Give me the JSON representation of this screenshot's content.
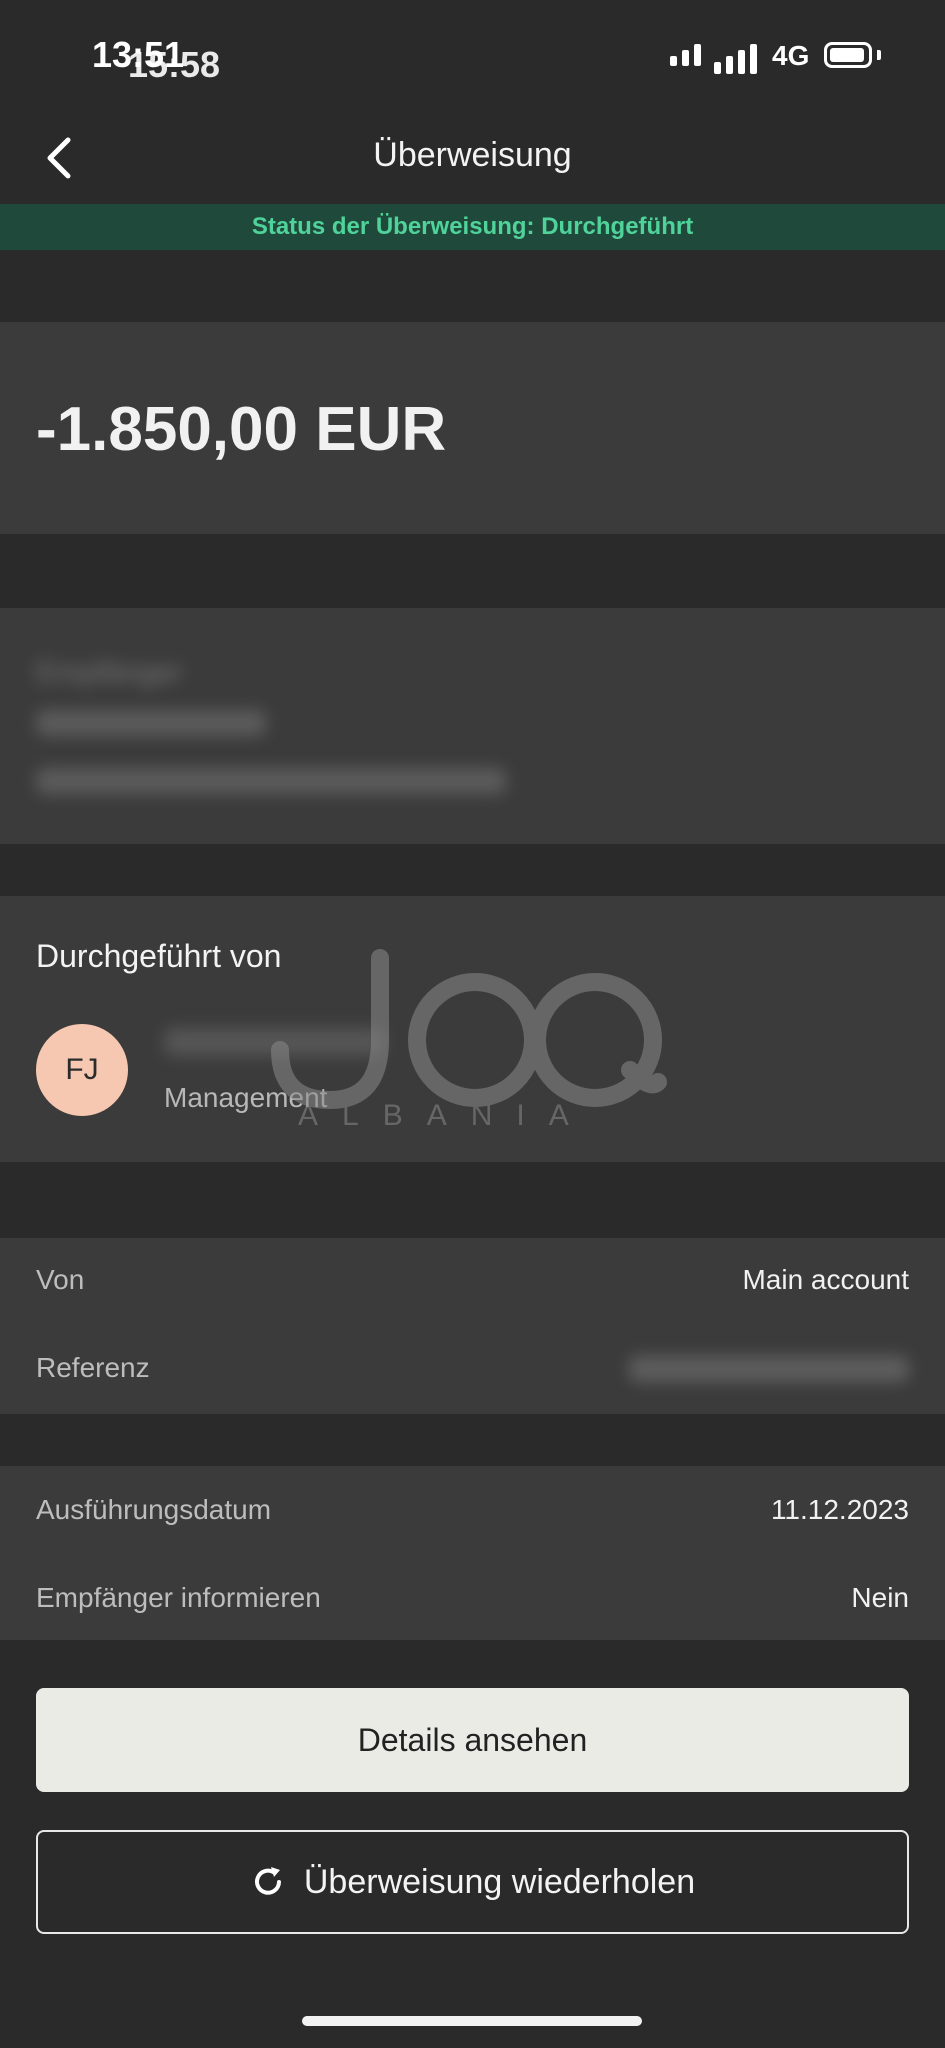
{
  "status_bar": {
    "time_primary": "13:51",
    "time_secondary": "15:58",
    "network": "4G"
  },
  "header": {
    "title": "Überweisung"
  },
  "banner": {
    "text": "Status der Überweisung: Durchgeführt"
  },
  "amount": {
    "value": "-1.850,00 EUR"
  },
  "recipient": {
    "label": "Empfänger"
  },
  "executed_by": {
    "title": "Durchgeführt von",
    "avatar_initials": "FJ",
    "subtitle": "Management"
  },
  "account_rows": [
    {
      "label": "Von",
      "value": "Main account"
    },
    {
      "label": "Referenz",
      "value": ""
    }
  ],
  "detail_rows": [
    {
      "label": "Ausführungsdatum",
      "value": "11.12.2023"
    },
    {
      "label": "Empfänger informieren",
      "value": "Nein"
    }
  ],
  "buttons": {
    "details": "Details ansehen",
    "repeat": "Überweisung wiederholen"
  },
  "watermark": {
    "text": "JOQ",
    "sub": "ALBANIA"
  }
}
